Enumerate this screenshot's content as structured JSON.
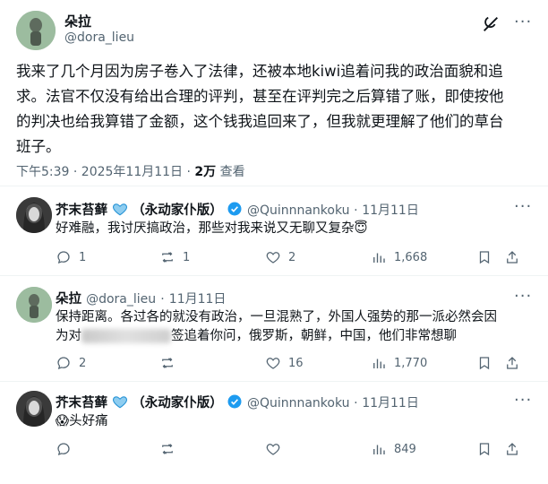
{
  "main_post": {
    "author_name": "朵拉",
    "author_handle": "@dora_lieu",
    "text_line1": "我来了几个月因为房子卷入了法律，还被本地kiwi追着问我的政治面貌和追",
    "text_line2": "求。法官不仅没有给出合理的评判，甚至在评判完之后算错了账，即使按他",
    "text_line3": "的判决也给我算错了金额，这个钱我追回来了，但我就更理解了他们的草台",
    "text_line4": "班子。",
    "timestamp": "下午5:39 · 2025年11月11日 · ",
    "views_count": "2万",
    "views_label": " 查看"
  },
  "replies": [
    {
      "author_name": "芥末苔藓",
      "name_suffix": "（永动家仆版）",
      "author_handle": "@Quinnnankoku",
      "date": "11月11日",
      "text": "好难融，我讨厌搞政治，那些对我来说又无聊又复杂",
      "emoji": "😇",
      "replies": "1",
      "reposts": "1",
      "likes": "2",
      "views": "1,668"
    },
    {
      "author_name": "朵拉",
      "author_handle": "@dora_lieu",
      "date": "11月11日",
      "text_line1": "保持距离。各过各的就没有政治，一旦混熟了，外国人强势的那一派必然会因",
      "text_line2a": "为对",
      "text_line2b": "签追着你问，俄罗斯，朝鲜，中国，他们非常想聊",
      "replies": "2",
      "reposts": "",
      "likes": "16",
      "views": "1,770"
    },
    {
      "author_name": "芥末苔藓",
      "name_suffix": "（永动家仆版）",
      "author_handle": "@Quinnnankoku",
      "date": "11月11日",
      "emoji": "😱",
      "text": "头好痛",
      "replies": "",
      "reposts": "",
      "likes": "",
      "views": "849"
    }
  ],
  "colors": {
    "verified_blue": "#1d9bf0",
    "text_primary": "#0f1419",
    "text_secondary": "#536471",
    "divider": "#eff3f4"
  },
  "icons": [
    "avatar-image",
    "more-icon",
    "reply-icon",
    "repost-icon",
    "like-icon",
    "views-icon",
    "bookmark-icon",
    "share-icon",
    "heart-badge-icon",
    "verified-badge-icon"
  ]
}
